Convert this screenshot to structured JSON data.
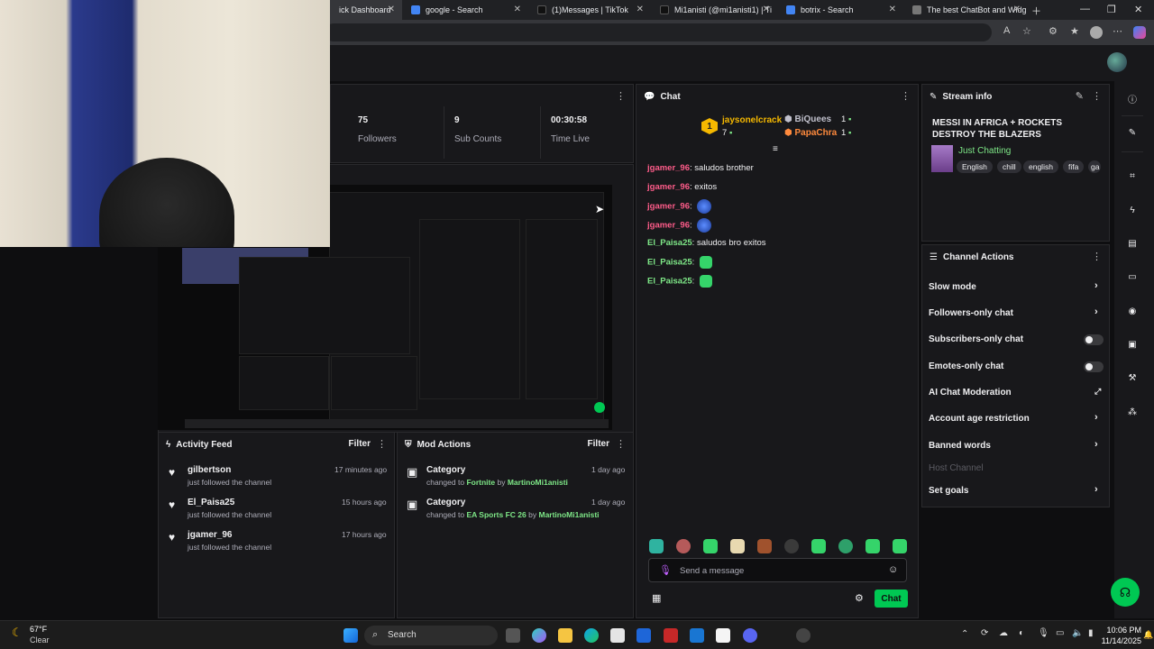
{
  "tabs": [
    {
      "label": "ick Dashboard"
    },
    {
      "label": "google - Search"
    },
    {
      "label": "(1)Messages | TikTok"
    },
    {
      "label": "Mi1anisti (@mi1anisti1) | Ti"
    },
    {
      "label": "botrix - Search"
    },
    {
      "label": "The best ChatBot and Widg"
    }
  ],
  "stats": [
    {
      "value": "75",
      "label": "Followers"
    },
    {
      "value": "9",
      "label": "Sub Counts"
    },
    {
      "value": "00:30:58",
      "label": "Time Live"
    }
  ],
  "chat": {
    "title": "Chat",
    "leaderboard": {
      "first_rank": "1",
      "first_name": "jaysonelcrack",
      "first_count": "7",
      "second_name": "BiQuees",
      "second_count": "1",
      "third_name": "PapaChra",
      "third_count": "1"
    },
    "messages": [
      {
        "user": "jgamer_96",
        "text": "saludos brother"
      },
      {
        "user": "jgamer_96",
        "text": "exitos"
      },
      {
        "user": "jgamer_96",
        "text": ""
      },
      {
        "user": "jgamer_96",
        "text": ""
      },
      {
        "user": "El_Paisa25",
        "text": "saludos bro exitos"
      },
      {
        "user": "El_Paisa25",
        "text": ""
      },
      {
        "user": "El_Paisa25",
        "text": ""
      }
    ],
    "input_placeholder": "Send a message",
    "send_label": "Chat"
  },
  "stream_info": {
    "title": "Stream info",
    "stream_title": "MESSI IN AFRICA + ROCKETS DESTROY THE BLAZERS",
    "category": "Just Chatting",
    "tags": [
      "English",
      "chill",
      "english",
      "fifa",
      "ga"
    ]
  },
  "channel_actions": {
    "title": "Channel Actions",
    "items": [
      {
        "label": "Slow mode"
      },
      {
        "label": "Followers-only chat"
      },
      {
        "label": "Subscribers-only chat"
      },
      {
        "label": "Emotes-only chat"
      },
      {
        "label": "AI Chat Moderation"
      },
      {
        "label": "Account age restriction"
      },
      {
        "label": "Banned words"
      },
      {
        "label": "Host Channel"
      },
      {
        "label": "Set goals"
      }
    ]
  },
  "activity_feed": {
    "title": "Activity Feed",
    "filter_label": "Filter",
    "items": [
      {
        "name": "gilbertson",
        "sub": "just followed the channel",
        "time": "17 minutes ago"
      },
      {
        "name": "El_Paisa25",
        "sub": "just followed the channel",
        "time": "15 hours ago"
      },
      {
        "name": "jgamer_96",
        "sub": "just followed the channel",
        "time": "17 hours ago"
      }
    ]
  },
  "mod_actions": {
    "title": "Mod Actions",
    "filter_label": "Filter",
    "items": [
      {
        "title": "Category",
        "prefix": "changed to",
        "game": "Fortnite",
        "by": "by",
        "user": "MartinoMi1anisti",
        "time": "1 day ago"
      },
      {
        "title": "Category",
        "prefix": "changed to",
        "game": "EA Sports FC 26",
        "by": "by",
        "user": "MartinoMi1anisti",
        "time": "1 day ago"
      }
    ]
  },
  "taskbar": {
    "weather_temp": "67°F",
    "weather_desc": "Clear",
    "search_label": "Search",
    "time": "10:06 PM",
    "date": "11/14/2025"
  },
  "colors": {
    "accent": "#00c853",
    "pink": "#ff5c8a",
    "green": "#7ee787"
  }
}
